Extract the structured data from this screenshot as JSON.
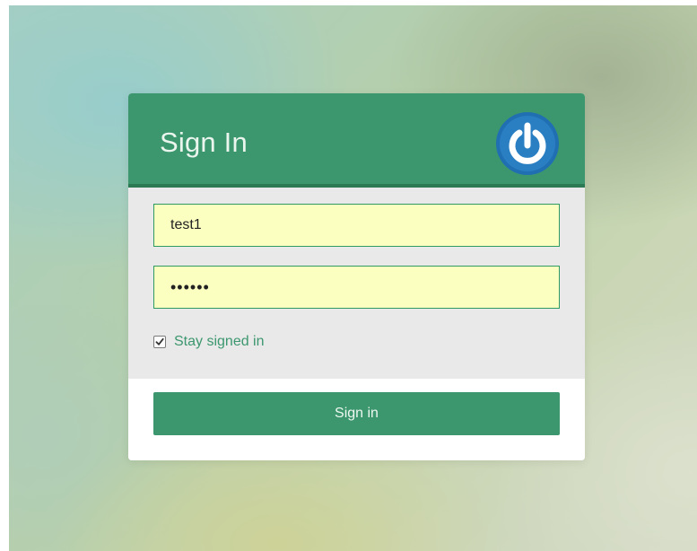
{
  "panel": {
    "title": "Sign In",
    "logo_icon": "power-icon",
    "header_color": "#3c976e",
    "logo_color": "#1f6fb2"
  },
  "form": {
    "username_value": "test1",
    "password_value": "••••••",
    "stay_signed_in_label": "Stay signed in",
    "stay_signed_in_checked": true,
    "field_fill_color": "#fbffc0",
    "field_border_color": "#2f9a62"
  },
  "actions": {
    "sign_in_label": "Sign in"
  }
}
